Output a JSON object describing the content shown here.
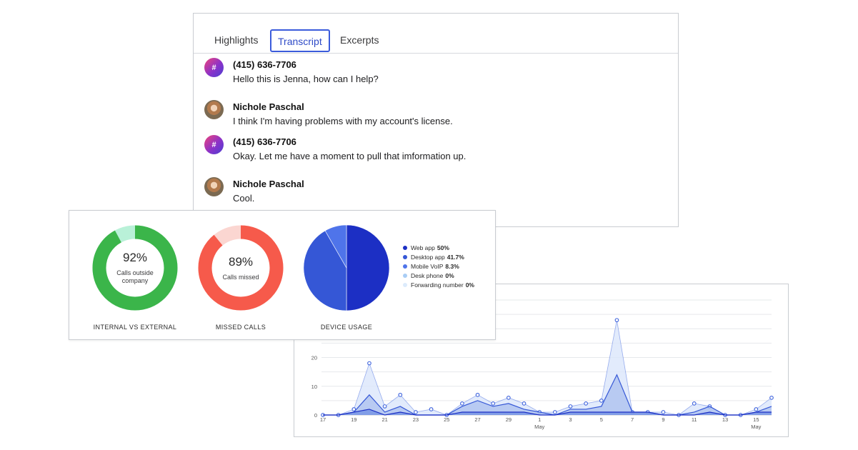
{
  "transcript": {
    "tabs": [
      {
        "label": "Highlights",
        "active": false
      },
      {
        "label": "Transcript",
        "active": true
      },
      {
        "label": "Excerpts",
        "active": false
      }
    ],
    "messages": [
      {
        "speaker": "(415) 636-7706",
        "avatar": "hash-icon",
        "avatar_glyph": "#",
        "text": "Hello this is Jenna, how can I help?"
      },
      {
        "speaker": "Nichole Paschal",
        "avatar": "person-avatar",
        "avatar_glyph": "",
        "text": "I think I'm having problems with my account's license."
      },
      {
        "speaker": "(415) 636-7706",
        "avatar": "hash-icon",
        "avatar_glyph": "#",
        "text": "Okay. Let me have a moment to pull that imformation up."
      },
      {
        "speaker": "Nichole Paschal",
        "avatar": "person-avatar",
        "avatar_glyph": "",
        "text": "Cool."
      }
    ]
  },
  "stats": {
    "internal_external": {
      "value": "92%",
      "fraction": 0.92,
      "caption": "Calls outside company",
      "label": "INTERNAL VS EXTERNAL",
      "color": "#3bb54a",
      "track_color": "#b9f1d8"
    },
    "missed_calls": {
      "value": "89%",
      "fraction": 0.89,
      "caption": "Calls missed",
      "label": "MISSED CALLS",
      "color": "#f65a4b",
      "track_color": "#fbd6d1"
    },
    "device_usage": {
      "label": "DEVICE USAGE",
      "items": [
        {
          "name": "Web app",
          "value": "50%",
          "fraction": 0.5,
          "color": "#1c2fc4"
        },
        {
          "name": "Desktop app",
          "value": "41.7%",
          "fraction": 0.417,
          "color": "#3557d6"
        },
        {
          "name": "Mobile VoIP",
          "value": "8.3%",
          "fraction": 0.083,
          "color": "#4f74ea"
        },
        {
          "name": "Desk phone",
          "value": "0%",
          "fraction": 0,
          "color": "#a9cdf5"
        },
        {
          "name": "Forwarding number",
          "value": "0%",
          "fraction": 0,
          "color": "#dcebfc"
        }
      ]
    }
  },
  "chart_data": {
    "type": "area",
    "title": "",
    "xlabel": "",
    "ylabel": "",
    "ylim": [
      0,
      40
    ],
    "y_ticks": [
      0,
      10,
      20
    ],
    "grid": true,
    "x": [
      "17",
      "18",
      "19",
      "20",
      "21",
      "22",
      "23",
      "24",
      "25",
      "26",
      "27",
      "28",
      "29",
      "30",
      "1",
      "2",
      "3",
      "4",
      "5",
      "6",
      "7",
      "8",
      "9",
      "10",
      "11",
      "12",
      "13",
      "14",
      "15",
      "16"
    ],
    "x_tick_labels": [
      "17",
      "19",
      "21",
      "23",
      "25",
      "27",
      "29",
      "1",
      "3",
      "5",
      "7",
      "9",
      "11",
      "13",
      "15"
    ],
    "x_month_labels": [
      {
        "at": "1",
        "label": "May"
      },
      {
        "at": "15",
        "label": "May"
      }
    ],
    "series": [
      {
        "values": [
          0,
          0,
          2,
          18,
          3,
          7,
          1,
          2,
          0,
          4,
          7,
          4,
          6,
          4,
          1,
          1,
          3,
          4,
          5,
          33,
          1,
          1,
          1,
          0,
          4,
          3,
          0,
          0,
          2,
          6
        ],
        "color": "#3e63dd",
        "fill": "#dbe6fb"
      },
      {
        "values": [
          0,
          0,
          1,
          7,
          1,
          3,
          0,
          0,
          0,
          3,
          5,
          3,
          4,
          2,
          1,
          0,
          2,
          2,
          3,
          14,
          1,
          1,
          0,
          0,
          1,
          3,
          0,
          0,
          1,
          3
        ],
        "color": "#3557d6",
        "fill": "#aabfef"
      },
      {
        "values": [
          0,
          0,
          1,
          2,
          0,
          1,
          0,
          0,
          0,
          1,
          1,
          1,
          1,
          1,
          0,
          0,
          1,
          1,
          1,
          1,
          1,
          1,
          0,
          0,
          0,
          1,
          0,
          0,
          1,
          1
        ],
        "color": "#1c2fc4",
        "fill": "#6f8ee3"
      }
    ]
  }
}
